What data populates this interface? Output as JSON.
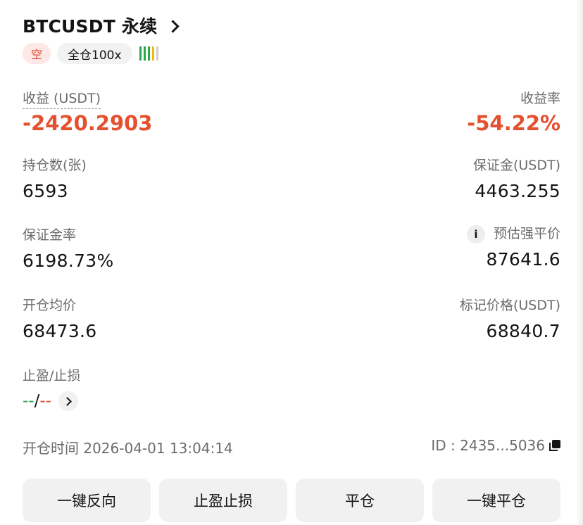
{
  "header": {
    "title": "BTCUSDT 永续"
  },
  "tags": {
    "side": "空",
    "mode": "全仓100x",
    "risk_colors": [
      "#2ba84a",
      "#2ba84a",
      "#2ba84a",
      "#f0b90b",
      "#cfcfcf"
    ]
  },
  "pnl": {
    "label": "收益 (USDT)",
    "value": "-2420.2903"
  },
  "roe": {
    "label": "收益率",
    "value": "-54.22%"
  },
  "position_size": {
    "label": "持仓数(张)",
    "value": "6593"
  },
  "margin": {
    "label": "保证金(USDT)",
    "value": "4463.255"
  },
  "margin_ratio": {
    "label": "保证金率",
    "value": "6198.73%"
  },
  "liq_price": {
    "label": "预估强平价",
    "value": "87641.6",
    "icon": "info-icon"
  },
  "entry_price": {
    "label": "开仓均价",
    "value": "68473.6"
  },
  "mark_price": {
    "label": "标记价格(USDT)",
    "value": "68840.7"
  },
  "tpsl": {
    "label": "止盈/止损",
    "tp": "--",
    "sep": "/",
    "sl": "--"
  },
  "open_time": {
    "text": "开仓时间 2026-04-01 13:04:14"
  },
  "position_id": {
    "text": "ID : 2435...5036"
  },
  "actions": {
    "reverse": "一键反向",
    "tpsl": "止盈止损",
    "close": "平仓",
    "close_all": "一键平仓"
  },
  "colors": {
    "loss": "#e5502f",
    "profit": "#2ba84a"
  }
}
